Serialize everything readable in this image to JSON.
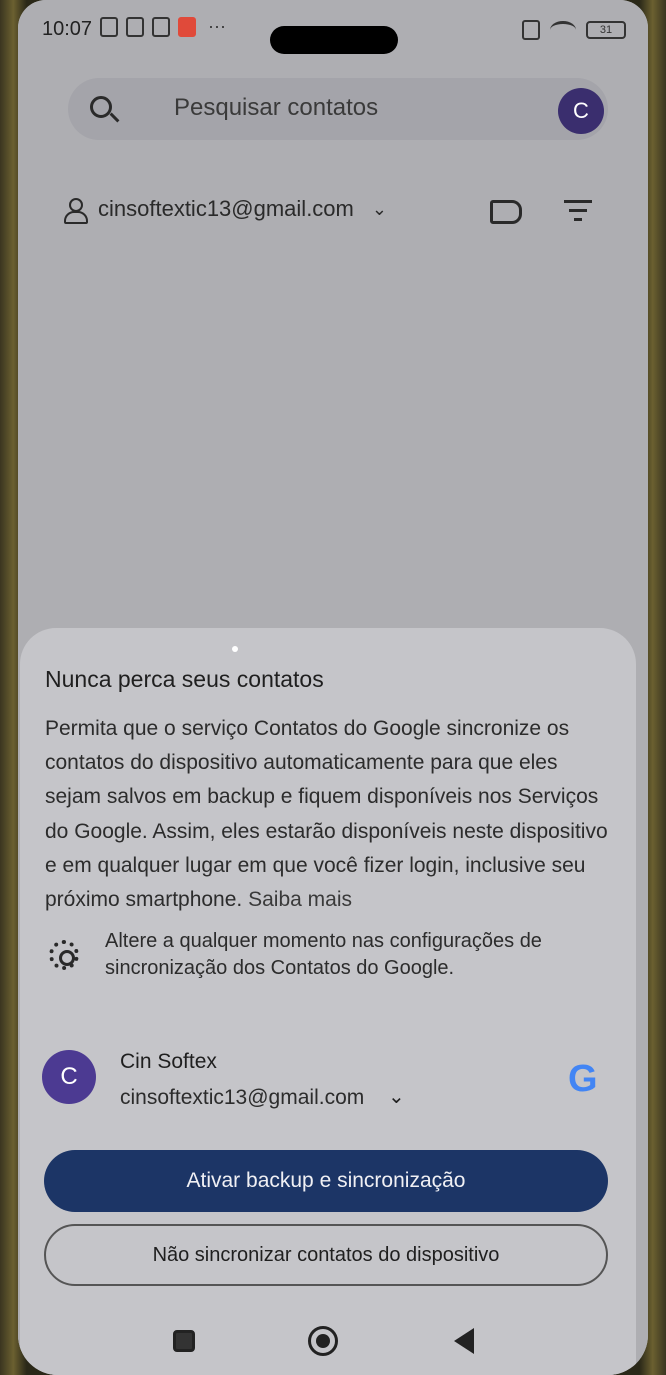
{
  "status_bar": {
    "time": "10:07",
    "battery": "31"
  },
  "search": {
    "placeholder": "Pesquisar contatos",
    "avatar_letter": "C"
  },
  "account": {
    "email": "cinsoftextic13@gmail.com"
  },
  "sheet": {
    "title": "Nunca perca seus contatos",
    "body": "Permita que o serviço Contatos do Google sincronize os contatos do dispositivo automaticamente para que eles sejam salvos em backup e fiquem disponíveis nos Serviços do Google. Assim, eles estarão disponíveis neste dispositivo e em qualquer lugar em que você fizer login, inclusive seu próximo smartphone.",
    "link": "Saiba mais",
    "settings_note": "Altere a qualquer momento nas configurações de sincronização dos Contatos do Google.",
    "account_name": "Cin Softex",
    "account_email": "cinsoftextic13@gmail.com",
    "account_avatar": "C",
    "google_logo": "G",
    "primary_button": "Ativar backup e sincronização",
    "secondary_button": "Não sincronizar contatos do dispositivo"
  },
  "icons": {
    "search": "search-icon",
    "label": "label-icon",
    "filter": "filter-icon",
    "gear": "gear-icon",
    "google": "google-icon",
    "nav_recents": "recents-icon",
    "nav_home": "home-icon",
    "nav_back": "back-icon"
  },
  "colors": {
    "primary_button": "#1c3566",
    "avatar": "#4c3a92"
  }
}
